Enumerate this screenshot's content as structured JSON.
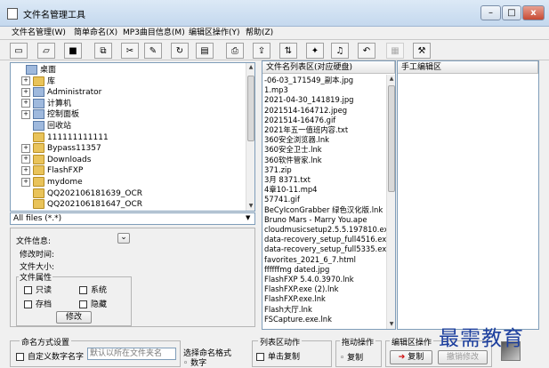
{
  "window": {
    "title": "文件名管理工具",
    "min": "–",
    "max": "□",
    "close": "x"
  },
  "menu": [
    "文件名管理(W)",
    "简单命名(X)",
    "MP3曲目信息(M)",
    "编辑区操作(Y)",
    "帮助(Z)"
  ],
  "toolbar_icons": [
    "new-folder-icon",
    "open-folder-icon",
    "save-icon",
    "copy-icon",
    "cut-icon",
    "edit-icon",
    "refresh-icon",
    "paste-icon",
    "print-icon",
    "export-icon",
    "sort-icon",
    "tag-icon",
    "music-icon",
    "undo-icon",
    "disabled-icon",
    "tool-icon"
  ],
  "tree": [
    {
      "label": "桌面",
      "level": 0,
      "expander": "",
      "icon": "desktop"
    },
    {
      "label": "库",
      "level": 1,
      "expander": "+",
      "icon": "folder"
    },
    {
      "label": "Administrator",
      "level": 1,
      "expander": "+",
      "icon": "user"
    },
    {
      "label": "计算机",
      "level": 1,
      "expander": "+",
      "icon": "computer"
    },
    {
      "label": "控制面板",
      "level": 1,
      "expander": "+",
      "icon": "panel"
    },
    {
      "label": "回收站",
      "level": 1,
      "expander": "",
      "icon": "recycle"
    },
    {
      "label": "111111111111",
      "level": 1,
      "expander": "",
      "icon": "folder"
    },
    {
      "label": "Bypass11357",
      "level": 1,
      "expander": "+",
      "icon": "folder"
    },
    {
      "label": "Downloads",
      "level": 1,
      "expander": "+",
      "icon": "folder"
    },
    {
      "label": "FlashFXP",
      "level": 1,
      "expander": "+",
      "icon": "folder"
    },
    {
      "label": "mydome",
      "level": 1,
      "expander": "+",
      "icon": "folder"
    },
    {
      "label": "QQ202106181639_OCR",
      "level": 1,
      "expander": "",
      "icon": "folder"
    },
    {
      "label": "QQ202106181647_OCR",
      "level": 1,
      "expander": "",
      "icon": "folder"
    }
  ],
  "filter": {
    "value": "All files (*.*)"
  },
  "fileinfo": {
    "title": "文件信息:",
    "modified": "修改时间:",
    "size": "文件大小:",
    "attr_title": "文件属性",
    "readonly": "只读",
    "system": "系统",
    "archive": "存档",
    "hidden": "隐藏",
    "modify": "修改",
    "collapse": "⌄"
  },
  "filelist": {
    "header": "文件名列表区(对应硬盘)",
    "items": [
      "-06-03_171549_副本.jpg",
      "1.mp3",
      "2021-04-30_141819.jpg",
      "2021514-164712.jpeg",
      "2021514-16476.gif",
      "2021年五一值班内容.txt",
      "360安全浏览器.lnk",
      "360安全卫士.lnk",
      "360软件管家.lnk",
      "371.zip",
      "3月 8371.txt",
      "4章10-11.mp4",
      "57741.gif",
      "BeCyIconGrabber 绿色汉化版.lnk",
      "Bruno Mars - Marry You.ape",
      "cloudmusicsetup2.5.5.197810.exe",
      "data-recovery_setup_full4516.exe",
      "data-recovery_setup_full5335.exe",
      "favorites_2021_6_7.html",
      "ffffffmg dated.jpg",
      "FlashFXP 5.4.0.3970.lnk",
      "FlashFXP.exe (2).lnk",
      "FlashFXP.exe.lnk",
      "Flash大厅.lnk",
      "FSCapture.exe.lnk"
    ]
  },
  "editarea": {
    "header": "手工编辑区"
  },
  "bottom": {
    "naming_title": "命名方式设置",
    "custom_num": "自定义数字名字",
    "custom_placeholder": "默认以所在文件夹名",
    "select_title": "选择命名格式",
    "select_opt": "数字",
    "listarea_title": "列表区动作",
    "single_copy": "单击复制",
    "drag_title": "拖动操作",
    "copy": "复制",
    "editop_title": "编辑区操作",
    "copy_btn": "复制",
    "undo_btn": "撤销修改"
  },
  "watermark": "最需教育"
}
